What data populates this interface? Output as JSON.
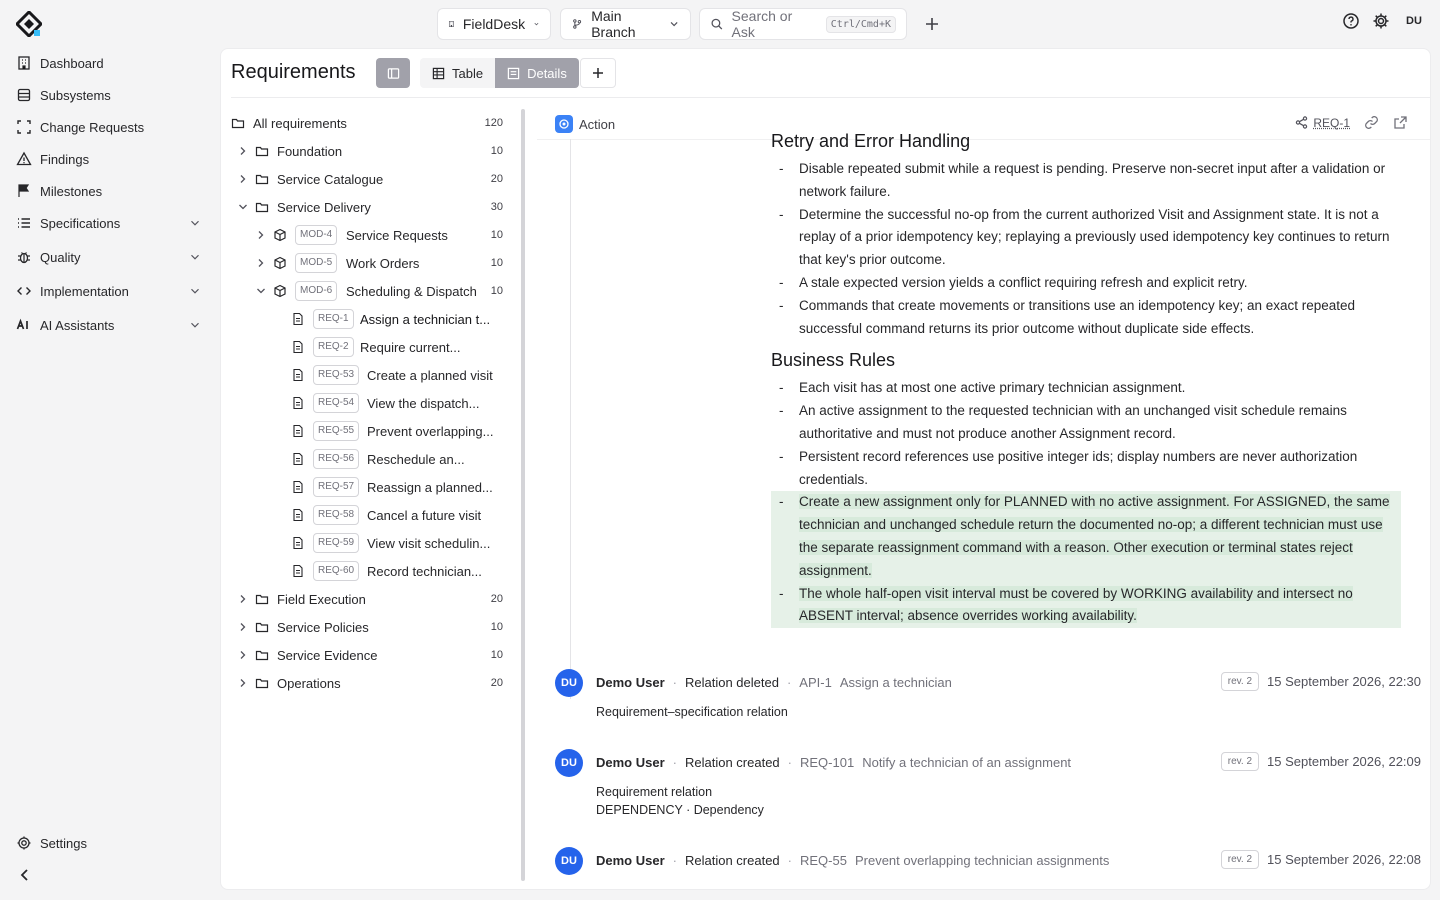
{
  "topbar": {
    "project": "FieldDesk",
    "branch": "Main Branch",
    "search_placeholder": "Search or Ask",
    "shortcut": "Ctrl/Cmd+K",
    "avatar": "DU"
  },
  "nav": {
    "items": [
      {
        "label": "Dashboard",
        "icon": "building-icon"
      },
      {
        "label": "Subsystems",
        "icon": "layers-icon"
      },
      {
        "label": "Change Requests",
        "icon": "bracket-icon"
      },
      {
        "label": "Findings",
        "icon": "warning-icon"
      },
      {
        "label": "Milestones",
        "icon": "flag-icon"
      },
      {
        "label": "Specifications",
        "icon": "list-icon"
      },
      {
        "label": "Quality",
        "icon": "bug-icon"
      },
      {
        "label": "Implementation",
        "icon": "code-icon"
      },
      {
        "label": "AI Assistants",
        "icon": "ai-icon"
      }
    ],
    "settings": "Settings"
  },
  "page": {
    "title": "Requirements",
    "view_table": "Table",
    "view_details": "Details"
  },
  "tree": {
    "all": {
      "label": "All requirements",
      "count": "120"
    },
    "folders": [
      {
        "label": "Foundation",
        "count": "10"
      },
      {
        "label": "Service Catalogue",
        "count": "20"
      },
      {
        "label": "Service Delivery",
        "count": "30"
      }
    ],
    "modules": [
      {
        "id": "MOD-4",
        "label": "Service Requests",
        "count": "10"
      },
      {
        "id": "MOD-5",
        "label": "Work Orders",
        "count": "10"
      },
      {
        "id": "MOD-6",
        "label": "Scheduling & Dispatch",
        "count": "10"
      }
    ],
    "reqs": [
      {
        "id": "REQ-1",
        "label": "Assign a technician t..."
      },
      {
        "id": "REQ-2",
        "label": "Require current..."
      },
      {
        "id": "REQ-53",
        "label": "Create a planned visit"
      },
      {
        "id": "REQ-54",
        "label": "View the dispatch..."
      },
      {
        "id": "REQ-55",
        "label": "Prevent overlapping..."
      },
      {
        "id": "REQ-56",
        "label": "Reschedule an..."
      },
      {
        "id": "REQ-57",
        "label": "Reassign a planned..."
      },
      {
        "id": "REQ-58",
        "label": "Cancel a future visit"
      },
      {
        "id": "REQ-59",
        "label": "View visit schedulin..."
      },
      {
        "id": "REQ-60",
        "label": "Record technician..."
      }
    ],
    "folders2": [
      {
        "label": "Field Execution",
        "count": "20"
      },
      {
        "label": "Service Policies",
        "count": "10"
      },
      {
        "label": "Service Evidence",
        "count": "10"
      },
      {
        "label": "Operations",
        "count": "20"
      }
    ]
  },
  "detail": {
    "type": "Action",
    "req_id": "REQ-1",
    "section1": "Retry and Error Handling",
    "section1_items": [
      "Disable repeated submit while a request is pending. Preserve non-secret input after a validation or network failure.",
      "Determine the successful no-op from the current authorized Visit and Assignment state. It is not a replay of a prior idempotency key; replaying a previously used idempotency key continues to return that key's prior outcome.",
      "A stale expected version yields a conflict requiring refresh and explicit retry.",
      "Commands that create movements or transitions use an idempotency key; an exact repeated successful command returns its prior outcome without duplicate side effects."
    ],
    "section2": "Business Rules",
    "section2_items": [
      "Each visit has at most one active primary technician assignment.",
      "An active assignment to the requested technician with an unchanged visit schedule remains authoritative and must not produce another Assignment record.",
      "Persistent record references use positive integer ids; display numbers are never authorization credentials."
    ],
    "section2_added": [
      "Create a new assignment only for PLANNED with no active assignment. For ASSIGNED, the same technician and unchanged schedule return the documented no-op; a different technician must use the separate reassignment command with a reason. Other execution or terminal states reject assignment.",
      "The whole half-open visit interval must be covered by WORKING availability and intersect no ABSENT interval; absence overrides working availability."
    ]
  },
  "activity": [
    {
      "avatar": "DU",
      "user": "Demo User",
      "action": "Relation deleted",
      "ref_id": "API-1",
      "ref_label": "Assign a technician",
      "rev": "rev. 2",
      "date": "15 September 2026, 22:30",
      "line1": "Requirement–specification relation",
      "line2": ""
    },
    {
      "avatar": "DU",
      "user": "Demo User",
      "action": "Relation created",
      "ref_id": "REQ-101",
      "ref_label": "Notify a technician of an assignment",
      "rev": "rev. 2",
      "date": "15 September 2026, 22:09",
      "line1": "Requirement relation",
      "line2": "DEPENDENCY · Dependency"
    },
    {
      "avatar": "DU",
      "user": "Demo User",
      "action": "Relation created",
      "ref_id": "REQ-55",
      "ref_label": "Prevent overlapping technician assignments",
      "rev": "rev. 2",
      "date": "15 September 2026, 22:08",
      "line1": "",
      "line2": ""
    }
  ]
}
